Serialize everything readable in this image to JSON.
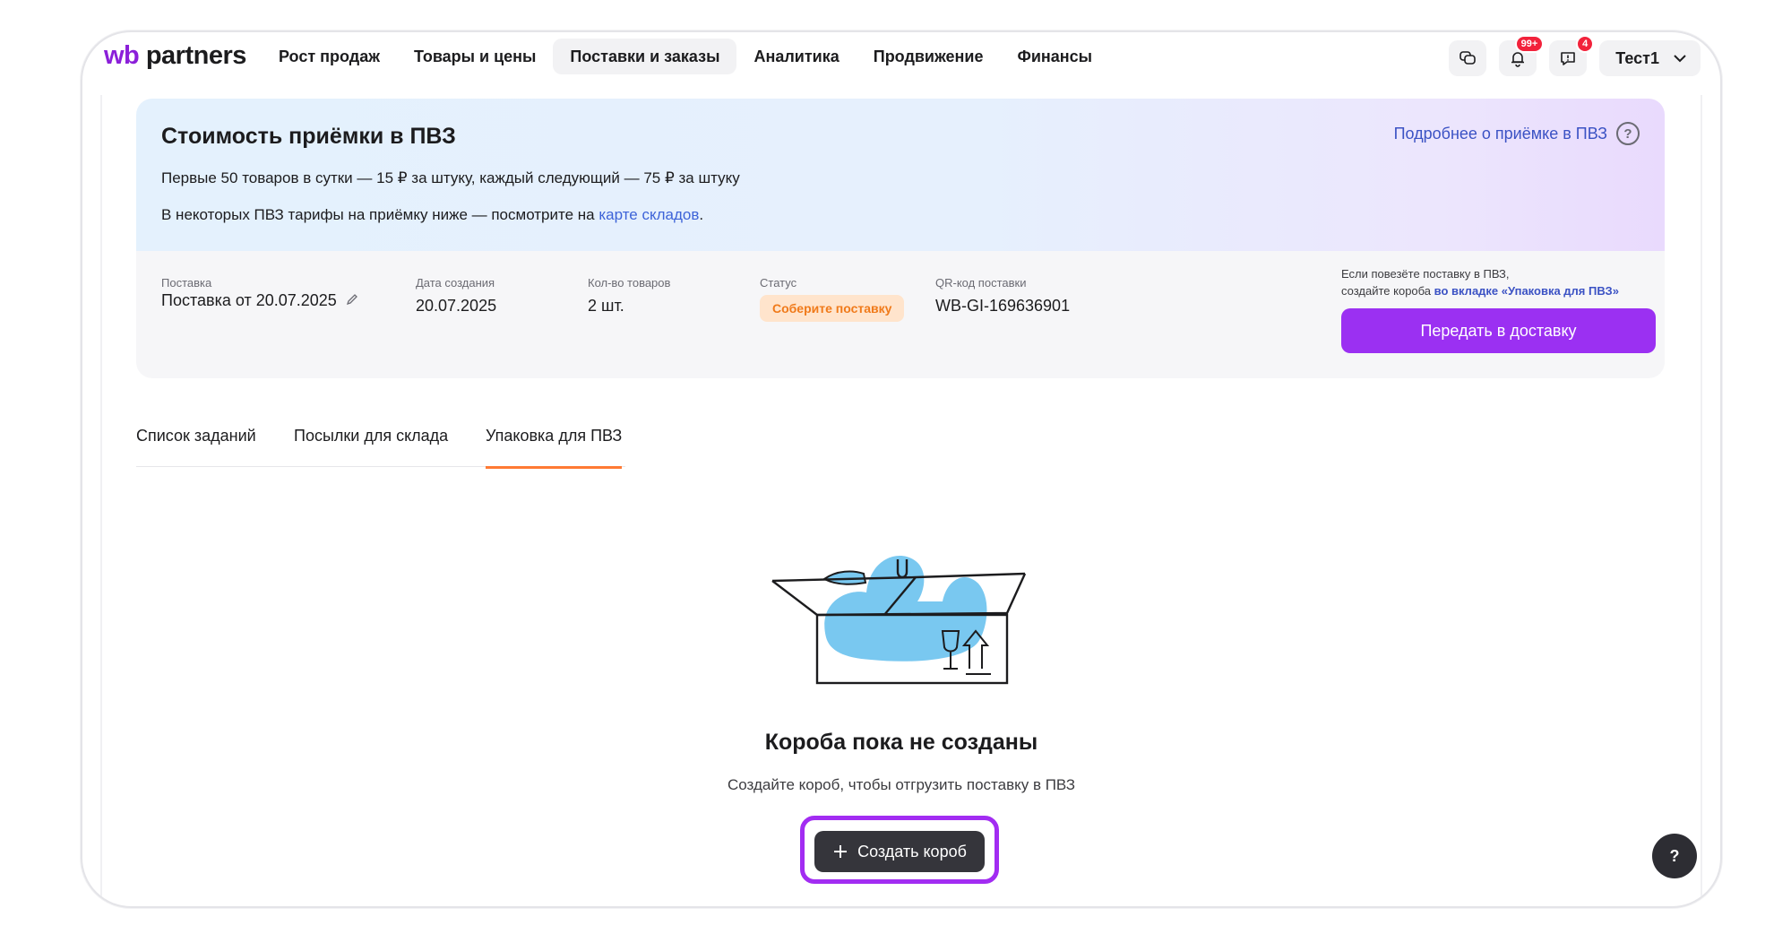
{
  "brand": {
    "logo_wb": "wb",
    "logo_partners": "partners",
    "accent": "#8b1fd9"
  },
  "nav": {
    "items": [
      {
        "label": "Рост продаж"
      },
      {
        "label": "Товары и цены"
      },
      {
        "label": "Поставки и заказы"
      },
      {
        "label": "Аналитика"
      },
      {
        "label": "Продвижение"
      },
      {
        "label": "Финансы"
      }
    ],
    "active_index": 2
  },
  "header_actions": {
    "chat_icon": "chat-icon",
    "notifications_badge": "99+",
    "support_badge": "4",
    "user_name": "Тест1"
  },
  "banner": {
    "title": "Стоимость приёмки в ПВЗ",
    "line1": "Первые 50 товаров в сутки — 15 ₽ за штуку, каждый следующий — 75 ₽ за штуку",
    "line2_prefix": "В некоторых ПВЗ тарифы на приёмку ниже — посмотрите на ",
    "line2_link": "карте складов",
    "line2_suffix": ".",
    "more_link": "Подробнее о приёмке в ПВЗ"
  },
  "supply": {
    "supply_label": "Поставка",
    "supply_value": "Поставка от 20.07.2025",
    "created_label": "Дата создания",
    "created_value": "20.07.2025",
    "count_label": "Кол-во товаров",
    "count_value": "2 шт.",
    "status_label": "Статус",
    "status_value": "Соберите поставку",
    "qr_label": "QR-код поставки",
    "qr_value": "WB-GI-169636901",
    "note_line1": "Если повезёте поставку в ПВЗ,",
    "note_line2_prefix": "создайте короба ",
    "note_line2_link": "во вкладке «Упаковка для ПВЗ»",
    "deliver_button": "Передать в доставку"
  },
  "tabs": {
    "items": [
      {
        "label": "Список заданий"
      },
      {
        "label": "Посылки для склада"
      },
      {
        "label": "Упаковка для ПВЗ"
      }
    ],
    "active_index": 2
  },
  "empty_state": {
    "title": "Короба пока не созданы",
    "text": "Создайте короб, чтобы отгрузить поставку в ПВЗ",
    "create_button": "Создать короб"
  },
  "help_fab": "?"
}
